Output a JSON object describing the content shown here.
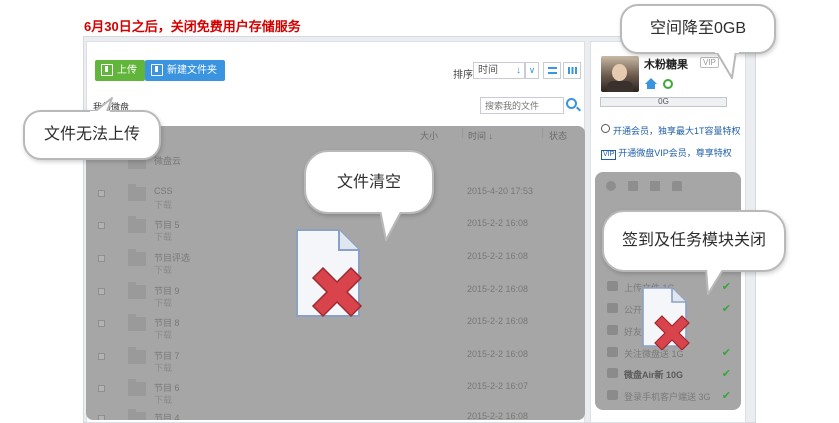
{
  "headline": "6月30日之后，关闭免费用户存储服务",
  "toolbar": {
    "upload_label": "上传",
    "new_folder_label": "新建文件夹",
    "sort_label": "排序",
    "sort_value": "时间"
  },
  "breadcrumb": "我的微盘",
  "search": {
    "placeholder": "搜索我的文件"
  },
  "file_list": {
    "columns": [
      "大小",
      "时间 ↓",
      "状态"
    ],
    "rows": [
      {
        "name": "微盘云",
        "sub": "",
        "time": ""
      },
      {
        "name": "CSS",
        "sub": "下载",
        "time": "2015-4-20 17:53"
      },
      {
        "name": "节目 5",
        "sub": "下载",
        "time": "2015-2-2 16:08"
      },
      {
        "name": "节目评选",
        "sub": "下载",
        "time": "2015-2-2 16:08"
      },
      {
        "name": "节目 9",
        "sub": "下载",
        "time": "2015-2-2 16:08"
      },
      {
        "name": "节目 8",
        "sub": "下载",
        "time": "2015-2-2 16:08"
      },
      {
        "name": "节目 7",
        "sub": "下载",
        "time": "2015-2-2 16:08"
      },
      {
        "name": "节目 6",
        "sub": "下载",
        "time": "2015-2-2 16:07"
      },
      {
        "name": "节目 4",
        "sub": "",
        "time": "2015-2-2 16:08"
      }
    ]
  },
  "user": {
    "name": "木粉糖果",
    "vip_badge": "VIP",
    "storage_text": "0G"
  },
  "promos": {
    "member": "开通会员，独享最大1T容量特权",
    "vip_badge": "VIP",
    "vip": "开通微盘VIP会员，尊享特权"
  },
  "tasks": [
    {
      "label": "上传文件 1G",
      "done": true
    },
    {
      "label": "公开",
      "done": true
    },
    {
      "label": "好友...2G",
      "done": false
    },
    {
      "label": "关注微盘送 1G",
      "done": true
    },
    {
      "label": "微盘Air新 10G",
      "done": true
    },
    {
      "label": "登录手机客户端送 3G",
      "done": true
    }
  ],
  "callouts": {
    "upload_disabled": "文件无法上传",
    "storage_zero": "空间降至0GB",
    "files_cleared": "文件清空",
    "tasks_closed": "签到及任务模块关闭"
  },
  "colors": {
    "headline": "#d40000",
    "upload_button": "#62b53b",
    "new_folder_button": "#3a94e0",
    "overlay": "#a6a6a6",
    "x_mark": "#d9434b"
  },
  "icons": [
    "upload-icon",
    "new-folder-icon",
    "list-view-icon",
    "grid-view-icon",
    "search-icon",
    "folder-icon",
    "home-icon",
    "friends-icon",
    "gear-icon",
    "trash-icon",
    "flag-icon",
    "bag-icon",
    "check-icon",
    "deleted-file-icon"
  ]
}
